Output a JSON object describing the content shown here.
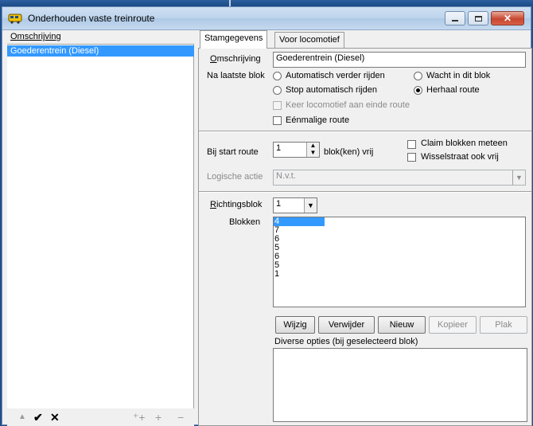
{
  "window": {
    "title": "Onderhouden vaste treinroute"
  },
  "left_panel": {
    "column_header": "Omschrijving",
    "items": [
      "Goederentrein (Diesel)"
    ],
    "toolbar": [
      "up-arrow-icon",
      "check-icon",
      "close-icon",
      "add-multiple-icon",
      "add-icon",
      "remove-icon"
    ]
  },
  "tabs": [
    "Stamgegevens",
    "Voor locomotief"
  ],
  "form": {
    "omschrijving_label": "Omschrijving",
    "omschrijving_value": "Goederentrein (Diesel)",
    "na_laatste_blok_label": "Na laatste blok",
    "radio_auto_verder": "Automatisch verder rijden",
    "radio_wacht": "Wacht in dit blok",
    "radio_stop": "Stop automatisch rijden",
    "radio_herhaal": "Herhaal route",
    "selected_radio": "Herhaal route",
    "check_keer": "Keer locomotief aan einde route",
    "check_eenmalige": "Eénmalige route",
    "bij_start_route_label": "Bij start route",
    "bij_start_route_value": "1",
    "blokken_vrij_label": "blok(ken) vrij",
    "check_claim": "Claim blokken meteen",
    "check_wisselstraat": "Wisselstraat ook vrij",
    "logische_actie_label": "Logische actie",
    "logische_actie_value": "N.v.t.",
    "richtingsblok_label": "Richtingsblok",
    "richtingsblok_value": "1",
    "blokken_label": "Blokken",
    "blokken": [
      "4",
      "7",
      "6",
      "5",
      "6",
      "5",
      "1"
    ],
    "buttons": {
      "wijzig": "Wijzig",
      "verwijder": "Verwijder",
      "nieuw": "Nieuw",
      "kopieer": "Kopieer",
      "plak": "Plak"
    },
    "diverse_opties_label": "Diverse opties (bij geselecteerd blok)"
  },
  "colors": {
    "selection": "#3399ff",
    "title_bar": "#bdd4ec",
    "background": "#f0f0f0"
  }
}
